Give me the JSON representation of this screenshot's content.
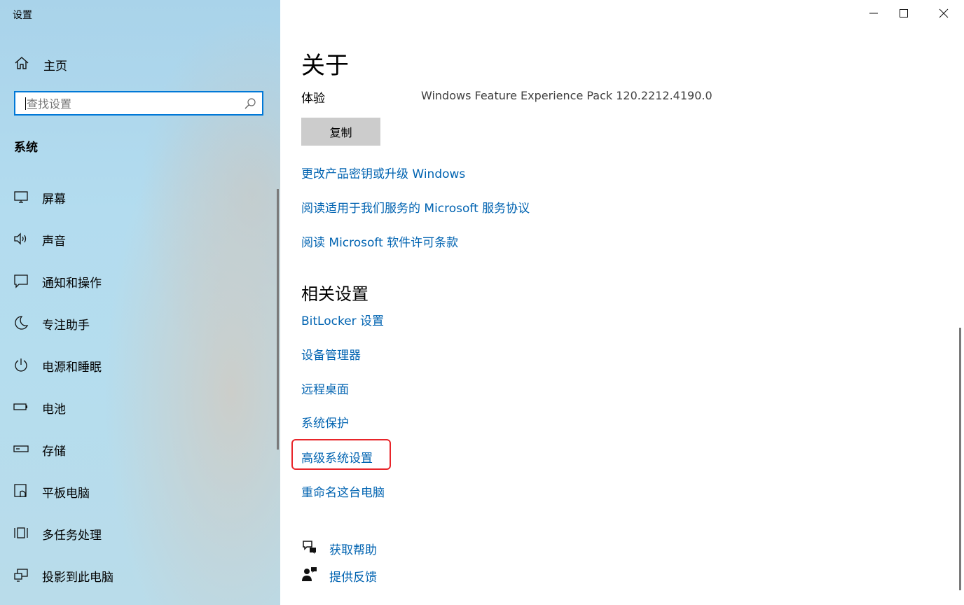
{
  "app_title": "设置",
  "sidebar": {
    "home_label": "主页",
    "search_placeholder": "查找设置",
    "section_title": "系统",
    "items": [
      {
        "label": "屏幕",
        "icon": "monitor-icon"
      },
      {
        "label": "声音",
        "icon": "speaker-icon"
      },
      {
        "label": "通知和操作",
        "icon": "notification-icon"
      },
      {
        "label": "专注助手",
        "icon": "moon-icon"
      },
      {
        "label": "电源和睡眠",
        "icon": "power-icon"
      },
      {
        "label": "电池",
        "icon": "battery-icon"
      },
      {
        "label": "存储",
        "icon": "storage-icon"
      },
      {
        "label": "平板电脑",
        "icon": "tablet-icon"
      },
      {
        "label": "多任务处理",
        "icon": "multitask-icon"
      },
      {
        "label": "投影到此电脑",
        "icon": "project-icon"
      }
    ]
  },
  "main": {
    "title": "关于",
    "experience_label": "体验",
    "experience_value": "Windows Feature Experience Pack 120.2212.4190.0",
    "copy_button": "复制",
    "links": [
      "更改产品密钥或升级 Windows",
      "阅读适用于我们服务的 Microsoft 服务协议",
      "阅读 Microsoft 软件许可条款"
    ],
    "related_title": "相关设置",
    "related_links": [
      "BitLocker 设置",
      "设备管理器",
      "远程桌面",
      "系统保护",
      "高级系统设置",
      "重命名这台电脑"
    ],
    "help_links": [
      {
        "label": "获取帮助",
        "icon": "help-chat-icon"
      },
      {
        "label": "提供反馈",
        "icon": "feedback-icon"
      }
    ]
  },
  "colors": {
    "accent": "#0078d7",
    "link": "#0063b1",
    "highlight_box": "#e8252a",
    "button_bg": "#cccccc"
  }
}
